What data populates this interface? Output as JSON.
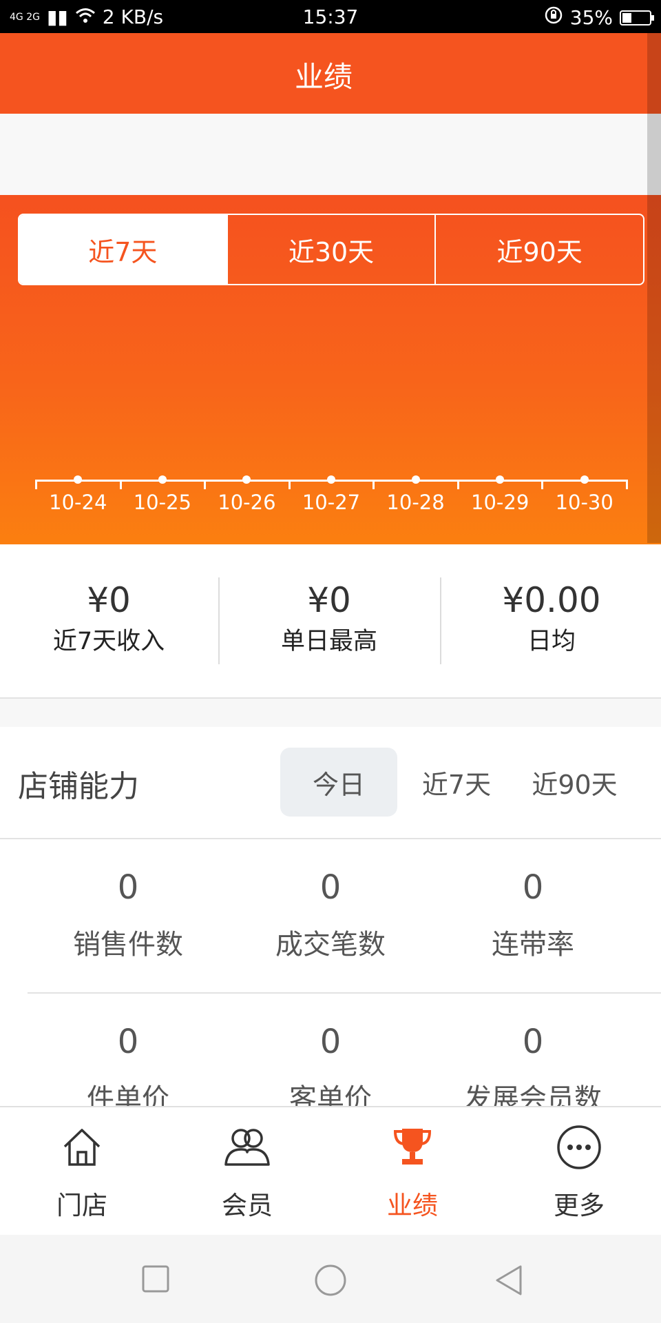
{
  "status_bar": {
    "network": "4G 2G",
    "speed": "2 KB/s",
    "time": "15:37",
    "battery": "35%",
    "battery_level": 0.35
  },
  "header": {
    "title": "业绩"
  },
  "range_tabs": [
    {
      "label": "近7天",
      "active": true
    },
    {
      "label": "近30天",
      "active": false
    },
    {
      "label": "近90天",
      "active": false
    }
  ],
  "chart_data": {
    "type": "line",
    "x": [
      "10-24",
      "10-25",
      "10-26",
      "10-27",
      "10-28",
      "10-29",
      "10-30"
    ],
    "series": [
      {
        "values": [
          0,
          0,
          0,
          0,
          0,
          0,
          0
        ]
      }
    ],
    "grid": false
  },
  "summary": [
    {
      "value": "¥0",
      "label": "近7天收入"
    },
    {
      "value": "¥0",
      "label": "单日最高"
    },
    {
      "value": "¥0.00",
      "label": "日均"
    }
  ],
  "store": {
    "title": "店铺能力",
    "periods": [
      {
        "label": "今日",
        "active": true
      },
      {
        "label": "近7天",
        "active": false
      },
      {
        "label": "近90天",
        "active": false
      }
    ],
    "metrics_row1": [
      {
        "value": "0",
        "label": "销售件数"
      },
      {
        "value": "0",
        "label": "成交笔数"
      },
      {
        "value": "0",
        "label": "连带率"
      }
    ],
    "metrics_row2": [
      {
        "value": "0",
        "label": "件单价"
      },
      {
        "value": "0",
        "label": "客单价"
      },
      {
        "value": "0",
        "label": "发展会员数"
      }
    ]
  },
  "tabbar": [
    {
      "label": "门店",
      "icon": "home-icon",
      "active": false
    },
    {
      "label": "会员",
      "icon": "members-icon",
      "active": false
    },
    {
      "label": "业绩",
      "icon": "trophy-icon",
      "active": true
    },
    {
      "label": "更多",
      "icon": "more-icon",
      "active": false
    }
  ],
  "colors": {
    "accent": "#f5541f",
    "accent_light": "#fb7f10"
  }
}
